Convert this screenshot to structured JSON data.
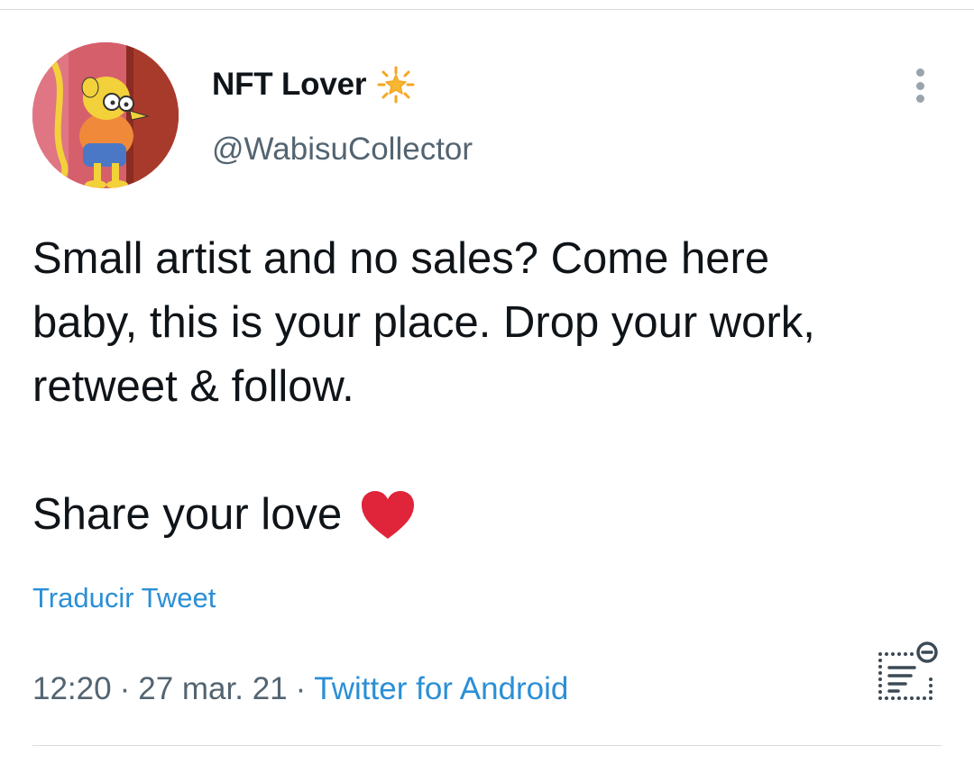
{
  "tweet": {
    "author": {
      "display_name": "NFT Lover",
      "handle": "@WabisuCollector",
      "badge_icon": "sparkle-star-icon",
      "avatar_icon": "cartoon-character-avatar"
    },
    "text_lines": [
      "Small artist and no sales? Come here",
      "baby, this is your place. Drop your work,",
      "retweet & follow."
    ],
    "share_line": "Share your love",
    "share_emoji_icon": "red-heart-icon",
    "translate_label": "Traducir Tweet",
    "time": "12:20",
    "date": "27 mar. 21",
    "separator": "·",
    "source": "Twitter for Android",
    "more_icon": "more-vertical-icon",
    "analytics_icon": "view-analytics-icon"
  },
  "colors": {
    "text": "#0f1419",
    "secondary_text": "#536471",
    "link": "#2b8fd6",
    "heart": "#e0243a",
    "badge": "#f5a623",
    "divider": "#d9dde0"
  }
}
